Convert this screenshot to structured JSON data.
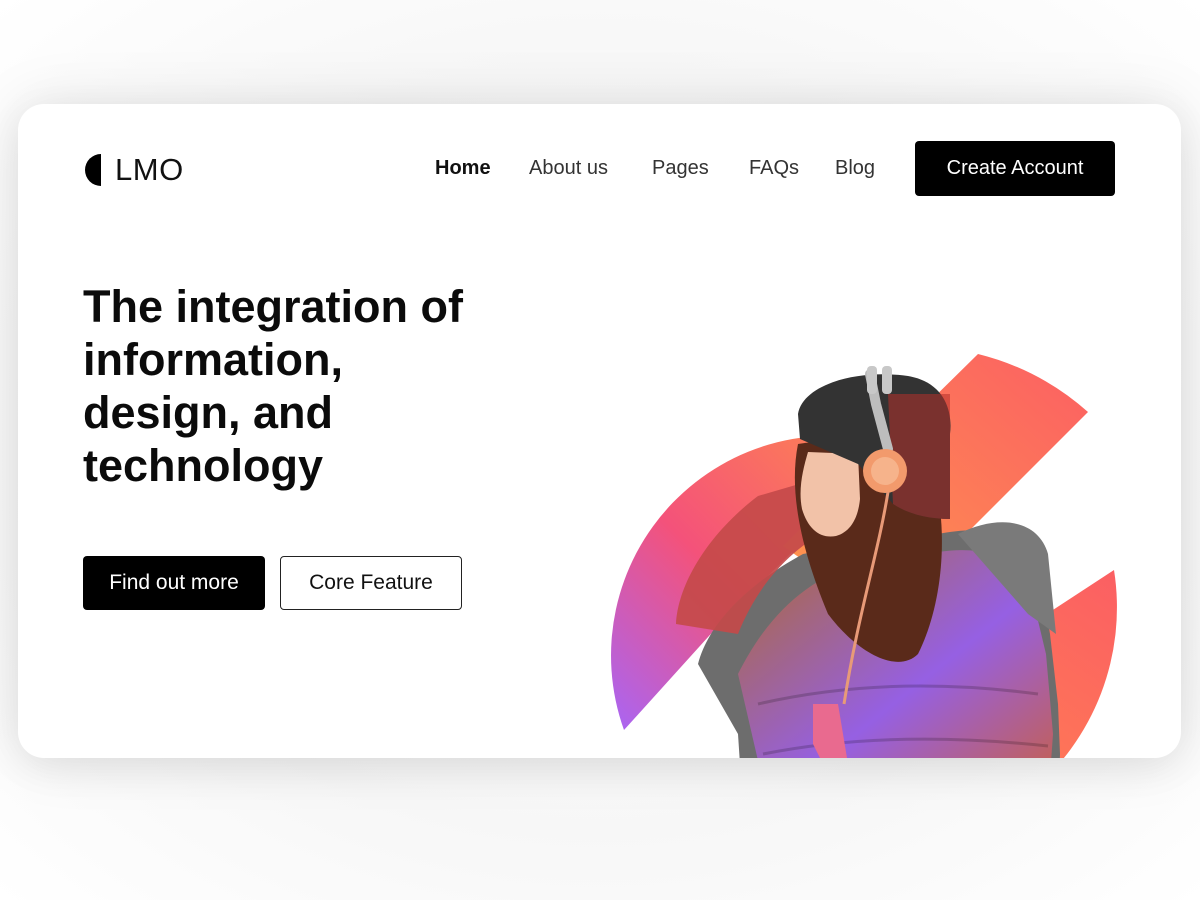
{
  "brand": {
    "name": "LMO",
    "icon": "half-circle-logo-icon"
  },
  "nav": {
    "items": [
      {
        "label": "Home",
        "active": true
      },
      {
        "label": "About us",
        "active": false
      },
      {
        "label": "Pages",
        "active": false
      },
      {
        "label": "FAQs",
        "active": false
      },
      {
        "label": "Blog",
        "active": false
      }
    ],
    "cta_label": "Create Account"
  },
  "hero": {
    "headline_lines": [
      "The integration of",
      "information,",
      "design, and",
      "technology"
    ],
    "primary_button": "Find out more",
    "secondary_button": "Core Feature",
    "illustration": "woman-with-headphones-photo"
  },
  "colors": {
    "primary": "#000000",
    "gradient_purple": "#a865f5",
    "gradient_pink": "#f4527a",
    "gradient_orange": "#ff8a4c",
    "gradient_yellow": "#ffb84a"
  }
}
